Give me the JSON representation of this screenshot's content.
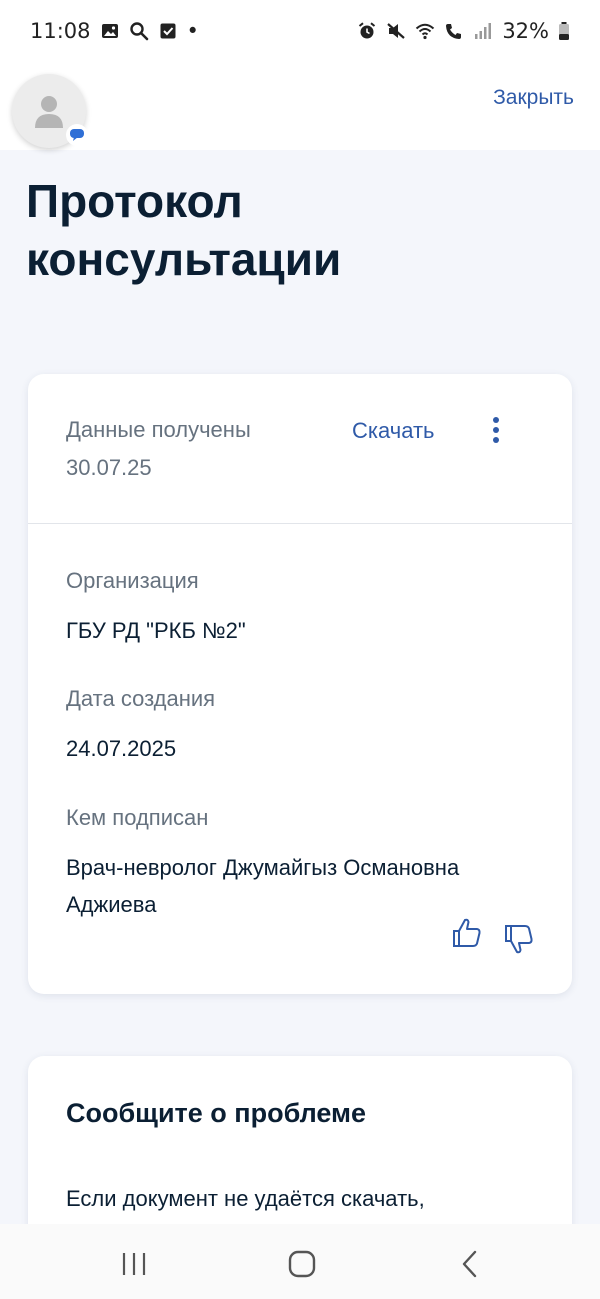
{
  "status_bar": {
    "time": "11:08",
    "dot": "•",
    "battery": "32%",
    "icons_left": [
      "image-icon",
      "search-icon",
      "checkbox-icon"
    ],
    "icons_right": [
      "alarm-icon",
      "mute-icon",
      "wifi-icon",
      "wifi-call-icon",
      "signal-icon",
      "battery-icon"
    ]
  },
  "header": {
    "close_label": "Закрыть"
  },
  "page": {
    "title_line1": "Протокол",
    "title_line2": "консультации"
  },
  "card": {
    "received_label": "Данные получены",
    "received_date": "30.07.25",
    "download_label": "Скачать",
    "organization_label": "Организация",
    "organization_value": "ГБУ РД \"РКБ №2\"",
    "created_label": "Дата создания",
    "created_value": "24.07.2025",
    "signed_label": "Кем подписан",
    "signed_value": "Врач-невролог Джумайгыз Османовна Аджиева"
  },
  "problem": {
    "title": "Сообщите о проблеме",
    "text": "Если документ не удаётся скачать,"
  },
  "colors": {
    "accent": "#2f5aa8",
    "text_primary": "#0b1f33",
    "text_secondary": "#66727f",
    "background": "#f4f6fb"
  }
}
